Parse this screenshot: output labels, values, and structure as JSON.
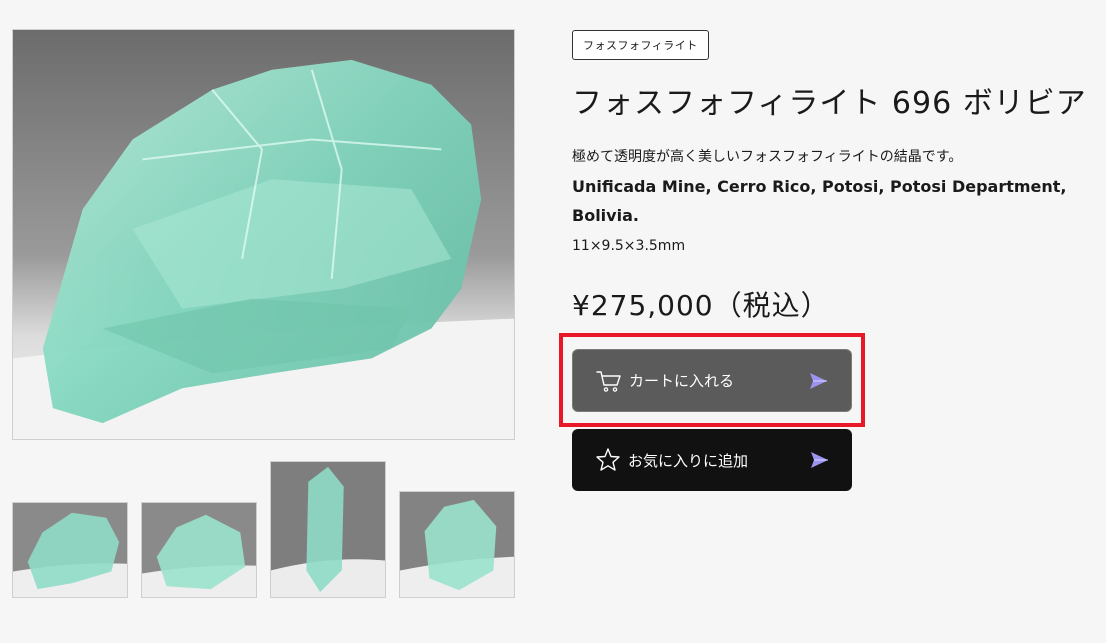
{
  "product": {
    "category_tag": "フォスフォフィライト",
    "title": "フォスフォフィライト 696 ボリビア",
    "description": "極めて透明度が高く美しいフォスフォフィライトの結晶です。",
    "locality": "Unificada Mine, Cerro Rico, Potosi, Potosi Department, Bolivia.",
    "dimensions": "11×9.5×3.5mm",
    "price": "¥275,000（税込）"
  },
  "actions": {
    "add_to_cart_label": "カートに入れる",
    "add_to_favorites_label": "お気に入りに追加"
  },
  "icons": {
    "cart": "cart-icon",
    "star": "star-icon",
    "send": "send-arrow-icon"
  },
  "colors": {
    "highlight": "#e8172a",
    "cart_button": "#5b5b5b",
    "favorite_button": "#111111",
    "send_arrow": "#9b93f0",
    "crystal": "#8fdcc6"
  }
}
